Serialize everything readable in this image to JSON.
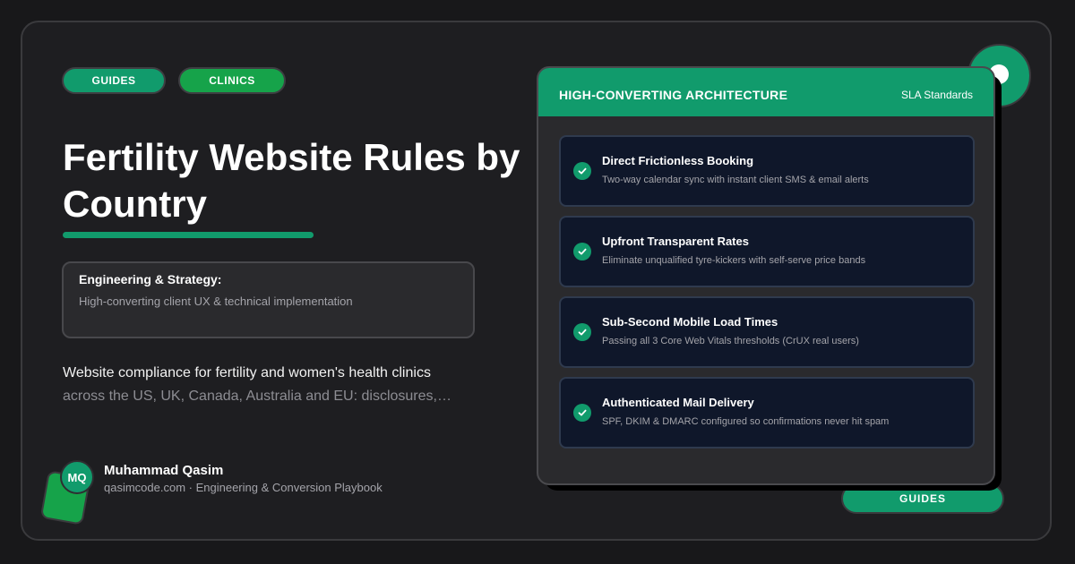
{
  "tags": {
    "guides": "GUIDES",
    "clinics": "CLINICS"
  },
  "title_line1": "Fertility Website Rules by",
  "title_line2": "Country",
  "strategy": {
    "heading": "Engineering & Strategy:",
    "subtitle": "High-converting client UX & technical implementation"
  },
  "description": {
    "line1": "Website compliance for fertility and women's health clinics",
    "line2": "across the US, UK, Canada, Australia and EU: disclosures,…"
  },
  "author": {
    "initials": "MQ",
    "name": "Muhammad Qasim",
    "subtitle": "qasimcode.com · Engineering & Conversion Playbook"
  },
  "card": {
    "title": "HIGH-CONVERTING ARCHITECTURE",
    "badge": "SLA Standards",
    "items": [
      {
        "title": "Direct Frictionless Booking",
        "subtitle": "Two-way calendar sync with instant client SMS & email alerts"
      },
      {
        "title": "Upfront Transparent Rates",
        "subtitle": "Eliminate unqualified tyre-kickers with self-serve price bands"
      },
      {
        "title": "Sub-Second Mobile Load Times",
        "subtitle": "Passing all 3 Core Web Vitals thresholds (CrUX real users)"
      },
      {
        "title": "Authenticated Mail Delivery",
        "subtitle": "SPF, DKIM & DMARC configured so confirmations never hit spam"
      }
    ]
  },
  "bottom_pill": "GUIDES",
  "colors": {
    "accent": "#119b6c",
    "clinics": "#16a34a",
    "background": "#18181a",
    "item_bg": "#0f172a"
  },
  "icons": [
    "check-circle-icon"
  ]
}
